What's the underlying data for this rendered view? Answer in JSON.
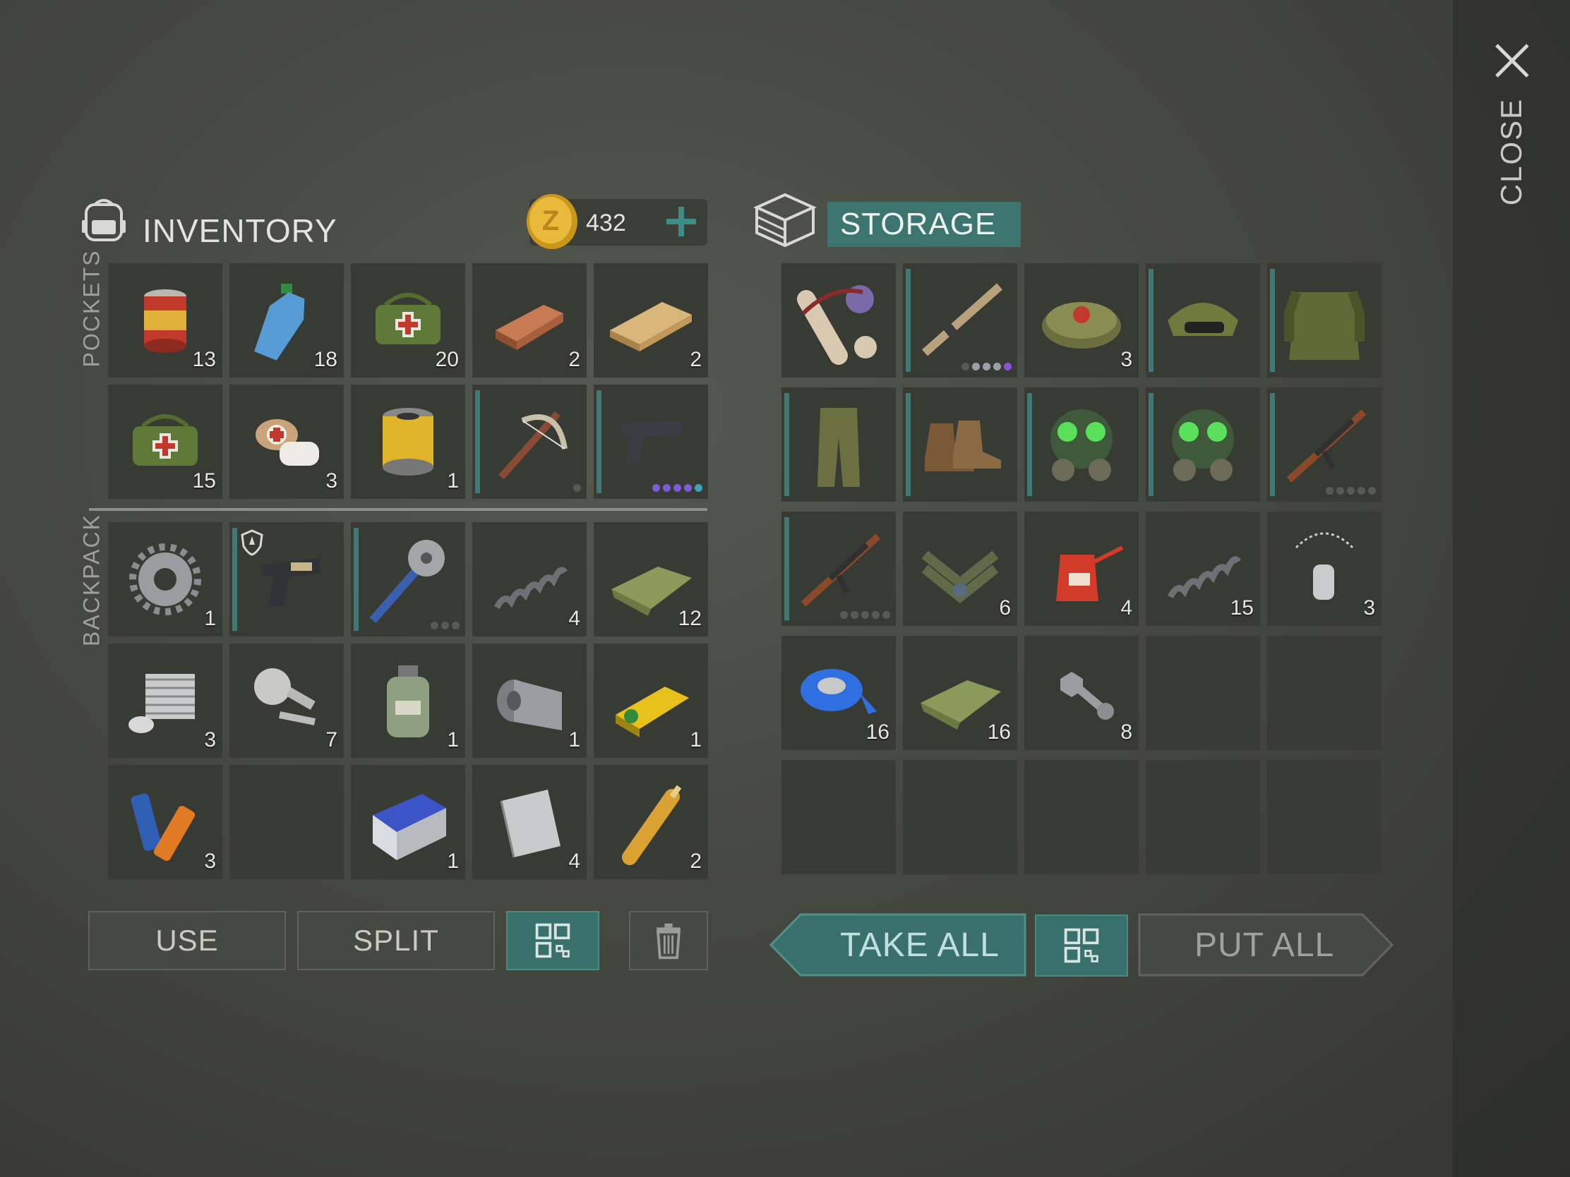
{
  "close": {
    "label": "CLOSE"
  },
  "inventory": {
    "title": "INVENTORY",
    "coins": "432",
    "pockets_label": "POCKETS",
    "backpack_label": "BACKPACK",
    "pockets": [
      {
        "icon": "canned-food-icon",
        "count": "13"
      },
      {
        "icon": "water-bottle-icon",
        "count": "18"
      },
      {
        "icon": "medkit-bag-icon",
        "count": "20"
      },
      {
        "icon": "copper-ingot-icon",
        "count": "2"
      },
      {
        "icon": "wood-plank-icon",
        "count": "2"
      },
      {
        "icon": "medkit-bag-icon",
        "count": "15"
      },
      {
        "icon": "bandage-icon",
        "count": "3"
      },
      {
        "icon": "air-filter-icon",
        "count": "1"
      },
      {
        "icon": "crossbow-icon",
        "bar": true,
        "dots": [
          "#585b54"
        ]
      },
      {
        "icon": "pistol-icon",
        "bar": true,
        "dots": [
          "#7d5bd6",
          "#7d5bd6",
          "#7d5bd6",
          "#7d5bd6",
          "#3fa4b8"
        ]
      }
    ],
    "backpack": [
      {
        "icon": "gear-icon",
        "count": "1"
      },
      {
        "icon": "desert-pistol-icon",
        "bar": true,
        "badge": true
      },
      {
        "icon": "saw-mace-icon",
        "bar": true,
        "dots": [
          "#585b54",
          "#585b54",
          "#585b54"
        ]
      },
      {
        "icon": "spring-icon",
        "count": "4"
      },
      {
        "icon": "cloth-icon",
        "count": "12"
      },
      {
        "icon": "engine-cylinder-icon",
        "count": "3"
      },
      {
        "icon": "motor-parts-icon",
        "count": "7"
      },
      {
        "icon": "acid-jar-icon",
        "count": "1"
      },
      {
        "icon": "metal-sheet-roll-icon",
        "count": "1"
      },
      {
        "icon": "radioactive-battery-icon",
        "count": "1"
      },
      {
        "icon": "batteries-icon",
        "count": "3"
      },
      {
        "icon": "",
        "empty": true
      },
      {
        "icon": "car-battery-icon",
        "count": "1"
      },
      {
        "icon": "steel-plate-icon",
        "count": "4"
      },
      {
        "icon": "ampoule-icon",
        "count": "2"
      }
    ]
  },
  "storage": {
    "title": "STORAGE",
    "items": [
      {
        "icon": "tarp-roll-icon"
      },
      {
        "icon": "assault-rifle-icon",
        "bar": true,
        "dots": [
          "#585b54",
          "#9aa0a8",
          "#9aa0a8",
          "#9aa0a8",
          "#8a54d6"
        ]
      },
      {
        "icon": "landmine-icon",
        "count": "3"
      },
      {
        "icon": "camo-hat-icon",
        "bar": true
      },
      {
        "icon": "tactical-vest-icon",
        "bar": true
      },
      {
        "icon": "camo-pants-icon",
        "bar": true
      },
      {
        "icon": "boots-icon",
        "bar": true
      },
      {
        "icon": "gas-mask-icon",
        "bar": true
      },
      {
        "icon": "gas-mask-icon",
        "bar": true
      },
      {
        "icon": "ak-rifle-icon",
        "bar": true,
        "dots": [
          "#585b54",
          "#585b54",
          "#585b54",
          "#585b54",
          "#585b54"
        ]
      },
      {
        "icon": "ak-rifle-icon",
        "bar": true,
        "dots": [
          "#585b54",
          "#585b54",
          "#585b54",
          "#585b54",
          "#585b54"
        ]
      },
      {
        "icon": "rank-chevron-icon",
        "count": "6"
      },
      {
        "icon": "oil-can-icon",
        "count": "4"
      },
      {
        "icon": "spring-icon",
        "count": "15"
      },
      {
        "icon": "dog-tag-icon",
        "count": "3"
      },
      {
        "icon": "duct-tape-icon",
        "count": "16"
      },
      {
        "icon": "cloth-icon",
        "count": "16"
      },
      {
        "icon": "bolt-nut-icon",
        "count": "8"
      },
      {
        "icon": "",
        "empty": true
      },
      {
        "icon": "",
        "empty": true
      },
      {
        "icon": "",
        "empty": true
      },
      {
        "icon": "",
        "empty": true
      },
      {
        "icon": "",
        "empty": true
      },
      {
        "icon": "",
        "empty": true
      },
      {
        "icon": "",
        "empty": true
      }
    ]
  },
  "buttons": {
    "use": "USE",
    "split": "SPLIT",
    "take_all": "TAKE ALL",
    "put_all": "PUT ALL"
  },
  "colors": {
    "accent": "#3b7a76",
    "cell": "#383b33",
    "background": "#4a4d44"
  }
}
